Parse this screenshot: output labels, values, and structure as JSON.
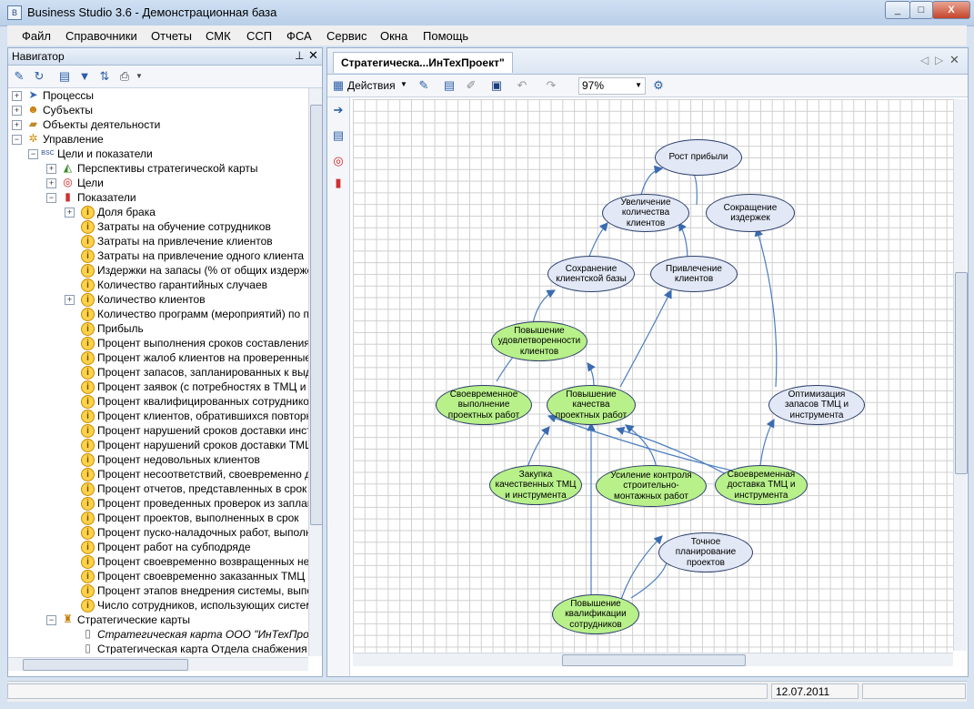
{
  "window": {
    "title": "Business Studio 3.6 - Демонстрационная база",
    "min": "_",
    "max": "□",
    "close": "X"
  },
  "menu": [
    "Файл",
    "Справочники",
    "Отчеты",
    "СМК",
    "ССП",
    "ФСА",
    "Сервис",
    "Окна",
    "Помощь"
  ],
  "navigator": {
    "title": "Навигатор",
    "tree": [
      {
        "label": "Процессы"
      },
      {
        "label": "Субъекты"
      },
      {
        "label": "Объекты деятельности"
      },
      {
        "label": "Управление"
      },
      {
        "label": "Цели и показатели"
      },
      {
        "label": "Перспективы стратегической карты"
      },
      {
        "label": "Цели"
      },
      {
        "label": "Показатели"
      },
      {
        "label": "Доля брака"
      },
      {
        "label": "Затраты на обучение сотрудников"
      },
      {
        "label": "Затраты на привлечение клиентов"
      },
      {
        "label": "Затраты на привлечение одного клиента"
      },
      {
        "label": "Издержки на запасы (% от общих издержек)"
      },
      {
        "label": "Количество гарантийных случаев"
      },
      {
        "label": "Количество клиентов"
      },
      {
        "label": "Количество программ (мероприятий) по повышению"
      },
      {
        "label": "Прибыль"
      },
      {
        "label": "Процент выполнения сроков составления плана"
      },
      {
        "label": "Процент жалоб клиентов на проверенные ра"
      },
      {
        "label": "Процент запасов, запланированных к выдаче"
      },
      {
        "label": "Процент заявок (с потребностях в ТМЦ и инс"
      },
      {
        "label": "Процент квалифицированных сотрудников"
      },
      {
        "label": "Процент клиентов, обратившихся повторно"
      },
      {
        "label": "Процент нарушений сроков доставки инстру"
      },
      {
        "label": "Процент нарушений сроков доставки ТМЦ"
      },
      {
        "label": "Процент недовольных клиентов"
      },
      {
        "label": "Процент несоответствий, своевременно дов"
      },
      {
        "label": "Процент отчетов, представленных в срок"
      },
      {
        "label": "Процент проведенных проверок из запланир"
      },
      {
        "label": "Процент проектов, выполненных в срок"
      },
      {
        "label": "Процент пуско-наладочных работ, выполнен"
      },
      {
        "label": "Процент работ на субподряде"
      },
      {
        "label": "Процент своевременно возвращенных непра"
      },
      {
        "label": "Процент своевременно заказанных ТМЦ и и"
      },
      {
        "label": "Процент этапов внедрения системы, выполн"
      },
      {
        "label": "Число сотрудников, использующих систему"
      },
      {
        "label": "Стратегические карты"
      },
      {
        "label": "Стратегическая карта ООО \"ИнТехПроект\""
      },
      {
        "label": "Стратегическая карта Отдела снабжения"
      }
    ]
  },
  "document": {
    "tab": "Стратегическа...ИнТехПроект\"",
    "actions_label": "Действия",
    "zoom": "97%"
  },
  "map": {
    "nodes": {
      "rost": "Рост прибыли",
      "uvel": "Увеличение количества клиентов",
      "sokr": "Сокращение издержек",
      "sohr": "Сохранение клиентской базы",
      "privl": "Привлечение клиентов",
      "udovl": "Повышение удовлетворенности клиентов",
      "svoevr": "Своевременное выполнение проектных работ",
      "kach": "Повышение качества проектных работ",
      "optim": "Оптимизация запасов ТМЦ и инструмента",
      "zakup": "Закупка качественных ТМЦ и инструмента",
      "usil": "Усиление контроля строительно-монтажных работ",
      "dost": "Своевременная доставка ТМЦ и инструмента",
      "plan": "Точное планирование проектов",
      "kval": "Повышение квалификации сотрудников"
    }
  },
  "status": {
    "date": "12.07.2011"
  }
}
